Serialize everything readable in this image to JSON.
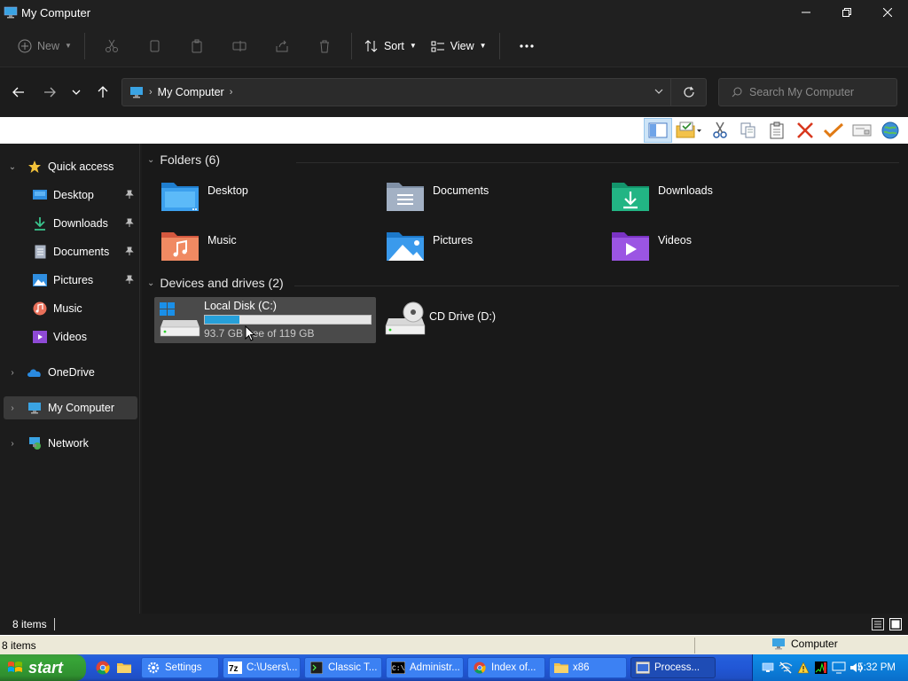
{
  "window": {
    "title": "My Computer"
  },
  "toolbar": {
    "new_label": "New",
    "sort_label": "Sort",
    "view_label": "View"
  },
  "address": {
    "crumbs": [
      "My Computer"
    ],
    "search_placeholder": "Search My Computer"
  },
  "sidebar": {
    "items": [
      {
        "label": "Quick access",
        "icon": "star-icon"
      },
      {
        "label": "Desktop",
        "icon": "desktop-folder-icon",
        "pinned": true
      },
      {
        "label": "Downloads",
        "icon": "download-icon",
        "pinned": true
      },
      {
        "label": "Documents",
        "icon": "document-icon",
        "pinned": true
      },
      {
        "label": "Pictures",
        "icon": "pictures-icon",
        "pinned": true
      },
      {
        "label": "Music",
        "icon": "music-icon"
      },
      {
        "label": "Videos",
        "icon": "videos-icon"
      },
      {
        "label": "OneDrive",
        "icon": "cloud-icon"
      },
      {
        "label": "My Computer",
        "icon": "computer-icon",
        "selected": true
      },
      {
        "label": "Network",
        "icon": "network-icon"
      }
    ]
  },
  "main": {
    "folders_header": "Folders (6)",
    "folders": [
      {
        "name": "Desktop",
        "icon": "desktop-folder-icon"
      },
      {
        "name": "Documents",
        "icon": "documents-folder-icon"
      },
      {
        "name": "Downloads",
        "icon": "downloads-folder-icon"
      },
      {
        "name": "Music",
        "icon": "music-folder-icon"
      },
      {
        "name": "Pictures",
        "icon": "pictures-folder-icon"
      },
      {
        "name": "Videos",
        "icon": "videos-folder-icon"
      }
    ],
    "drives_header": "Devices and drives (2)",
    "drives": [
      {
        "name": "Local Disk (C:)",
        "free_text": "93.7 GB free of 119 GB",
        "used_fraction": 0.21,
        "icon": "hard-drive-icon"
      },
      {
        "name": "CD Drive (D:)",
        "icon": "cd-drive-icon"
      }
    ]
  },
  "status": {
    "item_count": "8 items",
    "classic_left": "8 items",
    "classic_right": "Computer"
  },
  "taskbar": {
    "start_label": "start",
    "buttons": [
      {
        "label": "Settings",
        "icon": "gear-icon"
      },
      {
        "label": "C:\\Users\\...",
        "icon": "7zip-icon"
      },
      {
        "label": "Classic T...",
        "icon": "terminal-icon"
      },
      {
        "label": "Administr...",
        "icon": "cmd-icon"
      },
      {
        "label": "Index of...",
        "icon": "chrome-icon"
      },
      {
        "label": "x86",
        "icon": "folder-icon"
      },
      {
        "label": "Process...",
        "icon": "process-icon"
      }
    ],
    "clock": "5:32 PM"
  },
  "colors": {
    "accent": "#26a0da",
    "taskbar": "#245edb",
    "start": "#37a437"
  }
}
